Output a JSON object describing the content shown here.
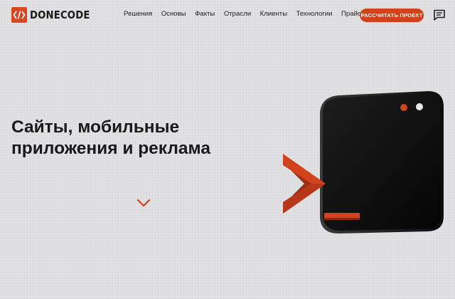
{
  "header": {
    "logo_text": "DONECODE",
    "nav": [
      {
        "label": "Решения"
      },
      {
        "label": "Основы"
      },
      {
        "label": "Факты"
      },
      {
        "label": "Отрасли"
      },
      {
        "label": "Клиенты"
      },
      {
        "label": "Технологии"
      },
      {
        "label": "Прайс"
      }
    ],
    "cta_label": "РАССЧИТАТЬ ПРОЕКТ"
  },
  "hero": {
    "title_line1": "Сайты, мобильные",
    "title_line2": "приложения и реклама"
  },
  "icons": {
    "logo": "code-brackets-icon",
    "chat": "chat-icon",
    "scroll": "chevron-down-icon"
  },
  "colors": {
    "accent": "#d2421c",
    "background": "#dcdbdd",
    "device": "#121212",
    "text": "#1a1a1a"
  }
}
